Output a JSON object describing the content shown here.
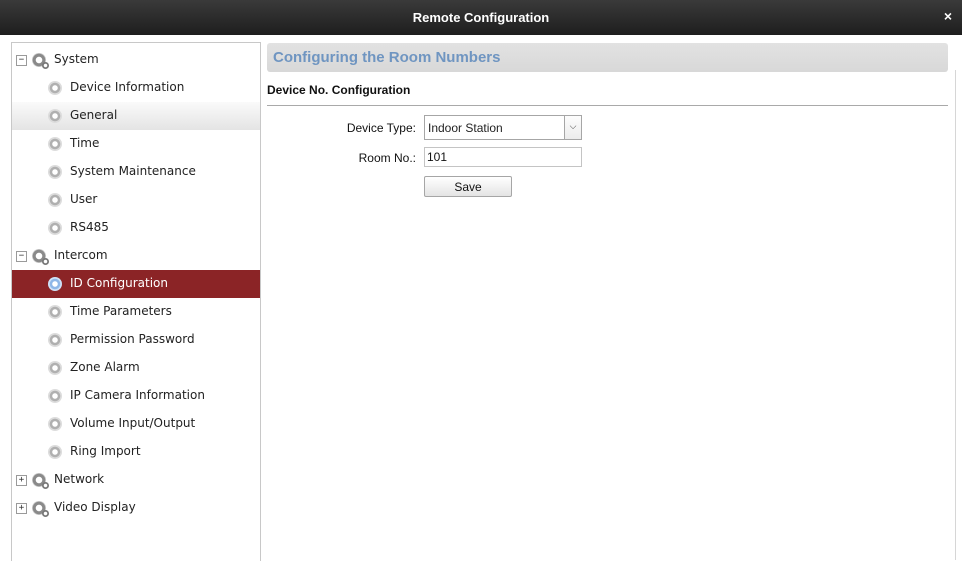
{
  "window": {
    "title": "Remote Configuration",
    "close_glyph": "×"
  },
  "tree": [
    {
      "label": "System",
      "level": 0,
      "toggle": "−",
      "icon": "system-gear-icon"
    },
    {
      "label": "Device Information",
      "level": 1,
      "icon": "gear-icon"
    },
    {
      "label": "General",
      "level": 1,
      "icon": "gear-icon",
      "state": "hover"
    },
    {
      "label": "Time",
      "level": 1,
      "icon": "gear-icon"
    },
    {
      "label": "System Maintenance",
      "level": 1,
      "icon": "gear-icon"
    },
    {
      "label": "User",
      "level": 1,
      "icon": "gear-icon"
    },
    {
      "label": "RS485",
      "level": 1,
      "icon": "gear-icon"
    },
    {
      "label": "Intercom",
      "level": 0,
      "toggle": "−",
      "icon": "system-gear-icon"
    },
    {
      "label": "ID Configuration",
      "level": 1,
      "icon": "gear-icon",
      "state": "selected"
    },
    {
      "label": "Time Parameters",
      "level": 1,
      "icon": "gear-icon"
    },
    {
      "label": "Permission Password",
      "level": 1,
      "icon": "gear-icon"
    },
    {
      "label": "Zone Alarm",
      "level": 1,
      "icon": "gear-icon"
    },
    {
      "label": "IP Camera Information",
      "level": 1,
      "icon": "gear-icon"
    },
    {
      "label": "Volume Input/Output",
      "level": 1,
      "icon": "gear-icon"
    },
    {
      "label": "Ring Import",
      "level": 1,
      "icon": "gear-icon"
    },
    {
      "label": "Network",
      "level": 0,
      "toggle": "+",
      "icon": "system-gear-icon"
    },
    {
      "label": "Video Display",
      "level": 0,
      "toggle": "+",
      "icon": "system-gear-icon"
    }
  ],
  "main": {
    "header": "Configuring the Room Numbers",
    "section_title": "Device No. Configuration",
    "device_type_label": "Device Type:",
    "device_type_value": "Indoor Station",
    "room_no_label": "Room No.:",
    "room_no_value": "101",
    "save_label": "Save"
  },
  "colors": {
    "selected": "#8b2426",
    "header_text": "#6f95c1"
  }
}
